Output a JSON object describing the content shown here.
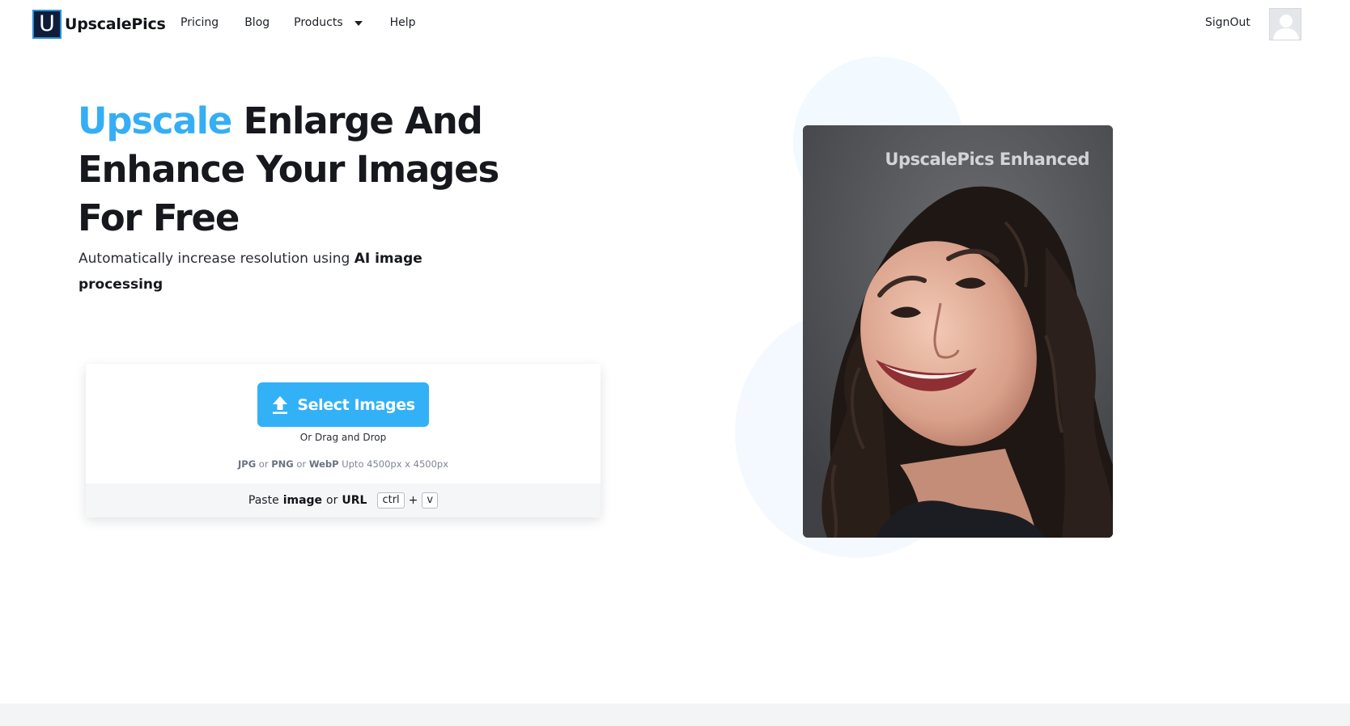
{
  "nav": {
    "logo_letter": "U",
    "brand": "UpscalePics",
    "links": [
      {
        "label": "Pricing"
      },
      {
        "label": "Blog"
      },
      {
        "label": "Products"
      },
      {
        "label": "Help"
      }
    ],
    "signout_label": "SignOut"
  },
  "hero": {
    "headline_accent": "Upscale",
    "headline_rest": " Enlarge And Enhance Your Images For Free",
    "sub_prefix": "Automatically increase resolution using ",
    "sub_bold": "AI image processing",
    "image_caption": "UpscalePics Enhanced",
    "image_subject": "smiling woman with curly hair"
  },
  "upload": {
    "button_label": "Select Images",
    "drag_text": "Or Drag and Drop",
    "format_jpg": "JPG",
    "format_or1": " or ",
    "format_png": "PNG",
    "format_or2": " or ",
    "format_webp": "WebP",
    "format_limit": " Upto 4500px x 4500px",
    "paste_prefix": "Paste",
    "paste_image": "image",
    "paste_or": "or",
    "paste_url": "URL",
    "key_ctrl": "ctrl",
    "key_plus": "+",
    "key_v": "v"
  },
  "colors": {
    "accent": "#35aef5",
    "button": "#33b1f7",
    "logo_bg": "#0f1d3a"
  },
  "icons": {
    "upload": "upload-arrow-icon",
    "dropdown": "chevron-down-icon",
    "avatar": "user-avatar-icon"
  }
}
